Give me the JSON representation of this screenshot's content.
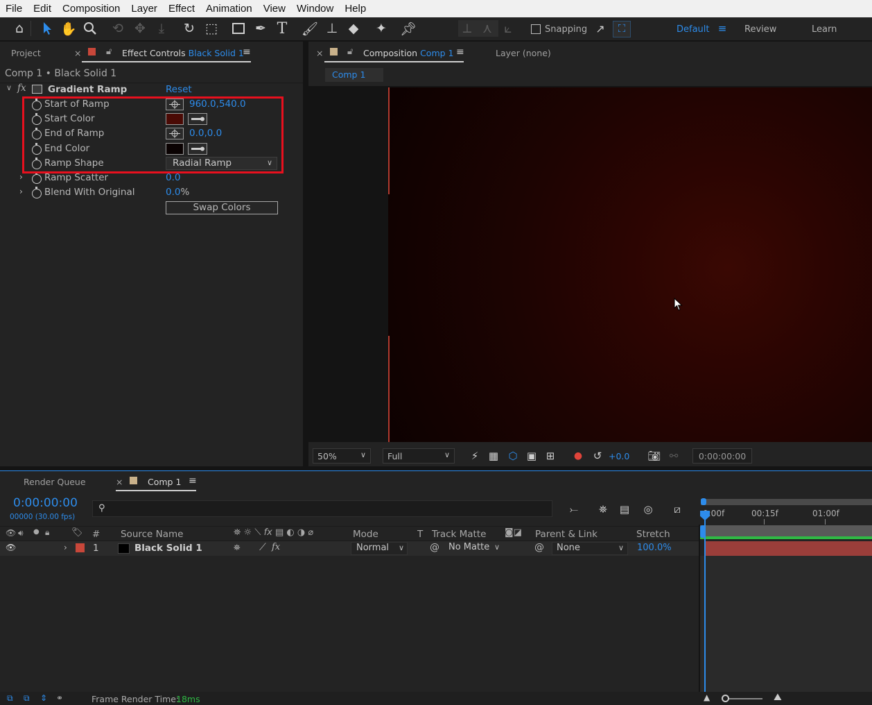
{
  "menu": [
    "File",
    "Edit",
    "Composition",
    "Layer",
    "Effect",
    "Animation",
    "View",
    "Window",
    "Help"
  ],
  "toolbar": {
    "snapping_label": "Snapping",
    "workspaces": {
      "default": "Default",
      "review": "Review",
      "learn": "Learn"
    }
  },
  "left_panel": {
    "tab_project": "Project",
    "tab_effect_controls": "Effect Controls",
    "tab_effect_controls_layer": "Black Solid 1",
    "breadcrumb": "Comp 1 • Black Solid 1",
    "effect": {
      "fx_label": "fx",
      "name": "Gradient Ramp",
      "reset_label": "Reset",
      "properties": [
        {
          "label": "Start of Ramp",
          "value": "960.0,540.0"
        },
        {
          "label": "Start Color",
          "color": "#4a0a05"
        },
        {
          "label": "End of Ramp",
          "value": "0.0,0.0"
        },
        {
          "label": "End Color",
          "color": "#0a0202"
        },
        {
          "label": "Ramp Shape",
          "value": "Radial Ramp"
        },
        {
          "label": "Ramp Scatter",
          "value": "0.0"
        },
        {
          "label": "Blend With Original",
          "value": "0.0",
          "unit": "%"
        }
      ],
      "swap_colors_label": "Swap Colors"
    }
  },
  "comp_panel": {
    "tab_composition": "Composition",
    "tab_comp_name": "Comp 1",
    "tab_layer": "Layer (none)",
    "sub_tab": "Comp 1",
    "zoom": "50%",
    "resolution": "Full",
    "exposure": "+0.0",
    "timecode": "0:00:00:00"
  },
  "timeline": {
    "tab_render_queue": "Render Queue",
    "tab_comp": "Comp 1",
    "current_time": "0:00:00:00",
    "frame_info": "00000 (30.00 fps)",
    "search_placeholder": "",
    "columns": {
      "number": "#",
      "source_name": "Source Name",
      "mode": "Mode",
      "track_matte_t": "T",
      "track_matte": "Track Matte",
      "parent_link": "Parent & Link",
      "stretch": "Stretch"
    },
    "ruler": [
      "0:00f",
      "00:15f",
      "01:00f"
    ],
    "layer": {
      "index": "1",
      "name": "Black Solid 1",
      "label_color": "#c8473a",
      "mode": "Normal",
      "track_matte": "No Matte",
      "parent": "None",
      "stretch": "100.0%"
    }
  },
  "status": {
    "frame_render_label": "Frame Render Time:",
    "frame_render_value": "18ms"
  }
}
